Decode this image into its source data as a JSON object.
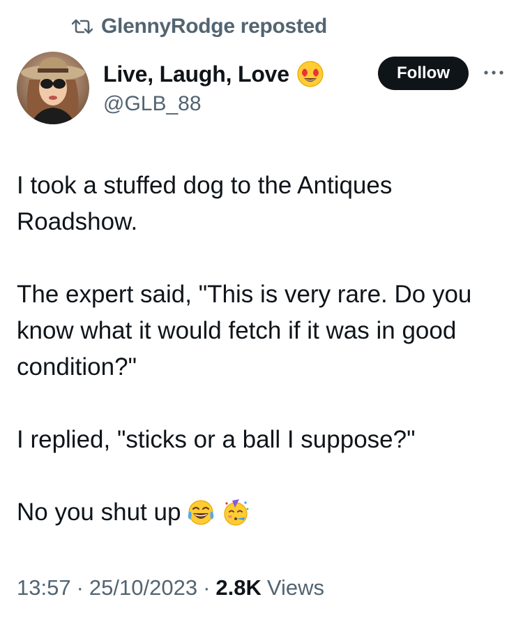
{
  "repost": {
    "icon": "repost-icon",
    "text": "GlennyRodge reposted"
  },
  "author": {
    "display_name": "Live, Laugh, Love",
    "name_emoji": "heart-eyes-emoji",
    "handle": "@GLB_88",
    "avatar": "avatar-photo"
  },
  "actions": {
    "follow_label": "Follow",
    "more_icon": "more-icon"
  },
  "tweet": {
    "paragraphs": [
      "I took a stuffed dog to the Antiques Roadshow.",
      "The expert said, \"This is very rare. Do you know what it would fetch if it was in good condition?\"",
      "I replied, \"sticks or a ball I suppose?\""
    ],
    "last_line": "No you shut up",
    "last_line_emojis": [
      "tears-of-joy-emoji",
      "partying-face-emoji"
    ]
  },
  "meta": {
    "time": "13:57",
    "separator": "·",
    "date": "25/10/2023",
    "views_count": "2.8K",
    "views_label": "Views"
  },
  "colors": {
    "text_primary": "#0f1419",
    "text_secondary": "#536471",
    "follow_bg": "#0f1419",
    "follow_text": "#ffffff"
  }
}
